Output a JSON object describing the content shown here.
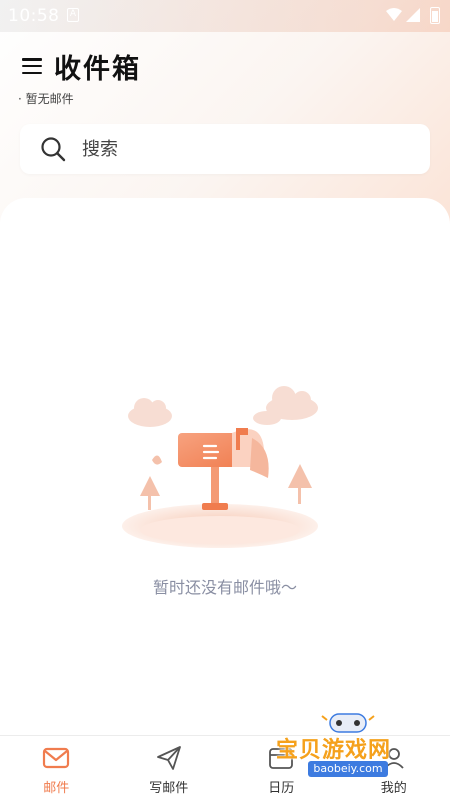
{
  "status_bar": {
    "time": "10:58",
    "notification_glyph": "A"
  },
  "header": {
    "title": "收件箱",
    "subtitle": "· 暂无邮件"
  },
  "search": {
    "placeholder": "搜索"
  },
  "empty_state": {
    "message": "暂时还没有邮件哦～"
  },
  "tabbar": {
    "items": [
      {
        "label": "邮件",
        "icon": "mail-icon",
        "active": true
      },
      {
        "label": "写邮件",
        "icon": "send-icon",
        "active": false
      },
      {
        "label": "日历",
        "icon": "calendar-icon",
        "active": false
      },
      {
        "label": "我的",
        "icon": "profile-icon",
        "active": false
      }
    ]
  },
  "watermark": {
    "title": "宝贝游戏网",
    "url": "baobeiy.com"
  },
  "colors": {
    "accent": "#f07c4e",
    "empty_text": "#8a8fa3",
    "watermark_orange": "#f5a11c",
    "watermark_blue": "#3d7be0"
  }
}
